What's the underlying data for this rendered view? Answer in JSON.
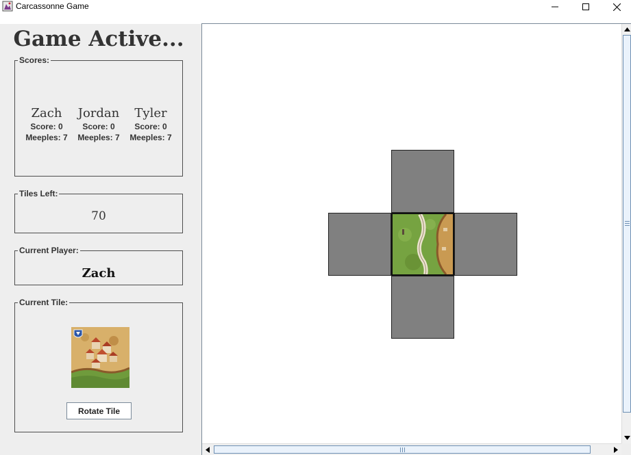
{
  "window": {
    "title": "Carcassonne Game",
    "controls": [
      "minimize",
      "maximize",
      "close"
    ]
  },
  "status": {
    "title": "Game Active..."
  },
  "scores": {
    "label": "Scores:",
    "players": [
      {
        "name": "Zach",
        "score": "Score: 0",
        "meeples": "Meeples: 7"
      },
      {
        "name": "Jordan",
        "score": "Score: 0",
        "meeples": "Meeples: 7"
      },
      {
        "name": "Tyler",
        "score": "Score: 0",
        "meeples": "Meeples: 7"
      }
    ]
  },
  "tiles_left": {
    "label": "Tiles Left:",
    "value": "70"
  },
  "current_player": {
    "label": "Current Player:",
    "value": "Zach"
  },
  "current_tile": {
    "label": "Current Tile:",
    "image": "city-tile-with-shield",
    "rotate_label": "Rotate Tile"
  },
  "board": {
    "placed_tiles": [
      {
        "image": "road-and-city-edge-tile"
      }
    ],
    "open_slots": [
      "north",
      "west",
      "east",
      "south"
    ],
    "colors": {
      "empty_slot": "#808080",
      "background": "#ffffff"
    }
  }
}
